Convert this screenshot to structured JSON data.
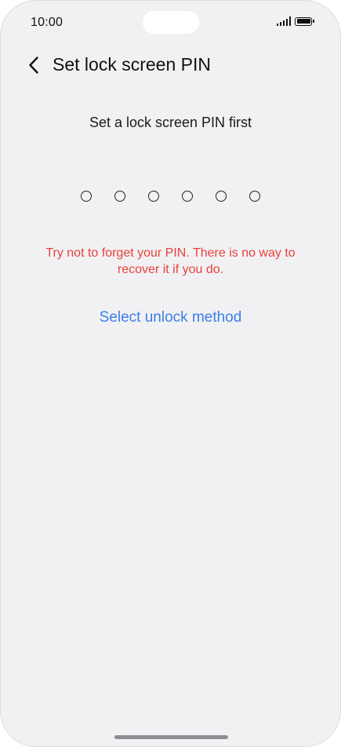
{
  "status_bar": {
    "time": "10:00",
    "signal_icon": "signal-icon",
    "battery_icon": "battery-icon"
  },
  "header": {
    "back_icon": "chevron-left-icon",
    "title": "Set lock screen PIN"
  },
  "main": {
    "subtitle": "Set a lock screen PIN first",
    "pin_length": 6,
    "pin_entered": 0,
    "warning": "Try not to forget your PIN. There is no way to recover it if you do.",
    "unlock_method_link": "Select unlock method"
  },
  "colors": {
    "warning": "#e8413c",
    "link": "#3b7ee8",
    "background": "#f1f1f3"
  }
}
